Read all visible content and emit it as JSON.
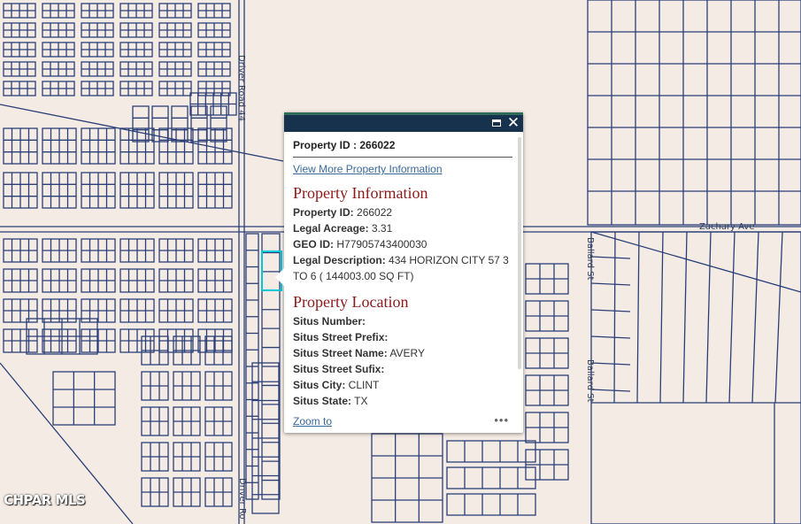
{
  "map": {
    "road_labels": {
      "driver_road_top": "Driver Road 44",
      "driver_road_bottom": "Driver Ro",
      "zachary": "Zachary Ave",
      "ballard_top": "Ballard St",
      "ballard_bottom": "Ballard St"
    },
    "watermark": "CHPAR MLS",
    "colors": {
      "background": "#f4ebe4",
      "parcel_line": "#2a3f78",
      "selection": "#00c8d8"
    }
  },
  "popup": {
    "header_icons": [
      "maximize-icon",
      "close-icon"
    ],
    "property_id_heading": "Property ID : 266022",
    "view_more_link": "View More Property Information",
    "section1_title": "Property Information",
    "rows1": [
      {
        "label": "Property ID:",
        "value": " 266022"
      },
      {
        "label": "Legal Acreage:",
        "value": " 3.31"
      },
      {
        "label": "GEO ID:",
        "value": " H77905743400030"
      },
      {
        "label": "Legal Description:",
        "value": " 434 HORIZON CITY 57 3 TO 6 ( 144003.00 SQ FT)"
      }
    ],
    "section2_title": "Property Location",
    "rows2": [
      {
        "label": "Situs Number:",
        "value": ""
      },
      {
        "label": "Situs Street Prefix:",
        "value": ""
      },
      {
        "label": "Situs Street Name:",
        "value": " AVERY"
      },
      {
        "label": "Situs Street Sufix:",
        "value": ""
      },
      {
        "label": "Situs City:",
        "value": " CLINT"
      },
      {
        "label": "Situs State:",
        "value": " TX"
      }
    ],
    "zoom_link": "Zoom to",
    "more_icon": "•••"
  }
}
